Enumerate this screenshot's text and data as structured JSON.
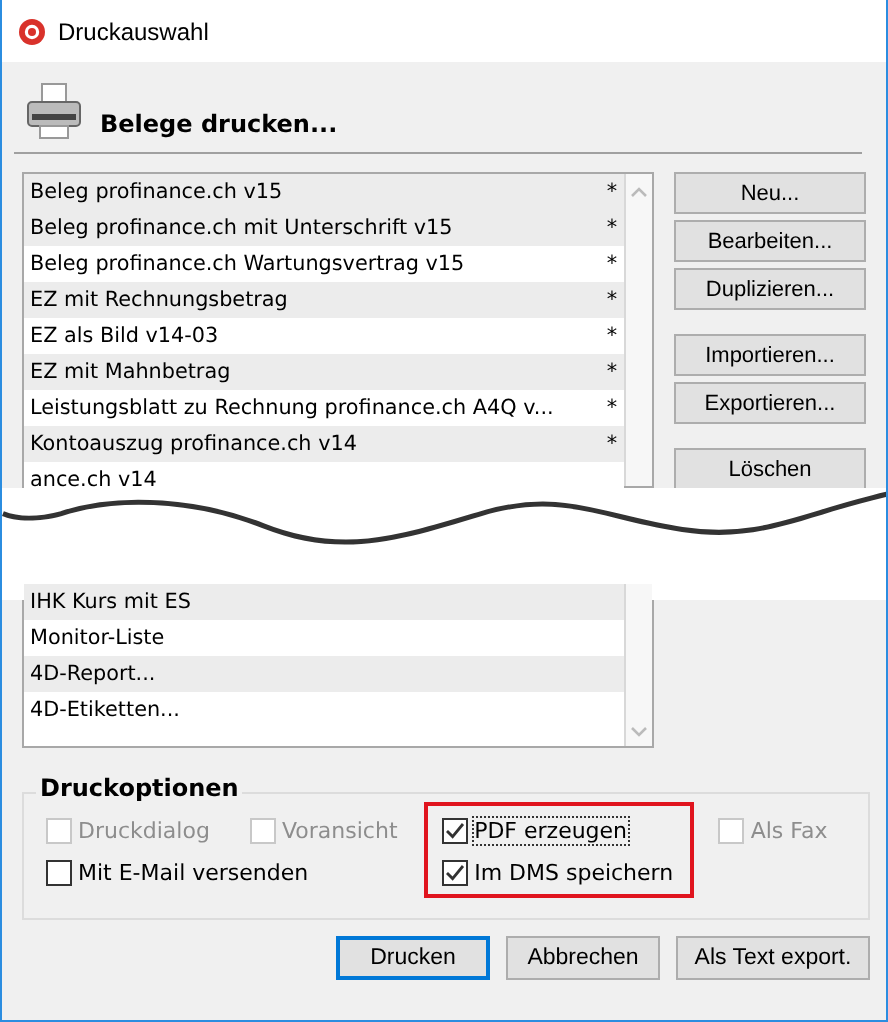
{
  "window": {
    "title": "Druckauswahl"
  },
  "header": {
    "title": "Belege drucken..."
  },
  "list_top": [
    {
      "name": "Beleg profinance.ch v15",
      "flag": "*"
    },
    {
      "name": "Beleg profinance.ch mit Unterschrift v15",
      "flag": "*"
    },
    {
      "name": "Beleg profinance.ch Wartungsvertrag v15",
      "flag": "*"
    },
    {
      "name": "EZ mit Rechnungsbetrag",
      "flag": "*"
    },
    {
      "name": "EZ als Bild v14-03",
      "flag": "*"
    },
    {
      "name": "EZ mit Mahnbetrag",
      "flag": "*"
    },
    {
      "name": "Leistungsblatt zu Rechnung profinance.ch A4Q v...",
      "flag": "*"
    },
    {
      "name": "Kontoauszug profinance.ch v14",
      "flag": "*"
    },
    {
      "name": "ance.ch v14"
    }
  ],
  "list_bottom": [
    {
      "name": "IHK Kurs mit ES"
    },
    {
      "name": "Monitor-Liste"
    },
    {
      "name": "4D-Report..."
    },
    {
      "name": "4D-Etiketten..."
    }
  ],
  "side_button_groups": [
    [
      "Neu...",
      "Bearbeiten...",
      "Duplizieren..."
    ],
    [
      "Importieren...",
      "Exportieren..."
    ],
    [
      "Löschen"
    ]
  ],
  "options": {
    "title": "Druckoptionen",
    "columns": [
      {
        "highlighted": false,
        "items": [
          {
            "label": "Druckdialog",
            "checked": false,
            "disabled": true,
            "focused": false
          },
          {
            "label": "Mit E-Mail versenden",
            "checked": false,
            "disabled": false,
            "focused": false
          }
        ]
      },
      {
        "highlighted": false,
        "items": [
          {
            "label": "Voransicht",
            "checked": false,
            "disabled": true,
            "focused": false
          }
        ]
      },
      {
        "highlighted": true,
        "items": [
          {
            "label": "PDF erzeugen",
            "checked": true,
            "disabled": false,
            "focused": true
          },
          {
            "label": "Im DMS speichern",
            "checked": true,
            "disabled": false,
            "focused": false
          }
        ]
      },
      {
        "highlighted": false,
        "items": [
          {
            "label": "Als Fax",
            "checked": false,
            "disabled": true,
            "focused": false
          }
        ]
      }
    ]
  },
  "buttons": [
    {
      "label": "Drucken",
      "default": true
    },
    {
      "label": "Abbrechen",
      "default": false
    },
    {
      "label": "Als Text export.",
      "default": false
    }
  ]
}
